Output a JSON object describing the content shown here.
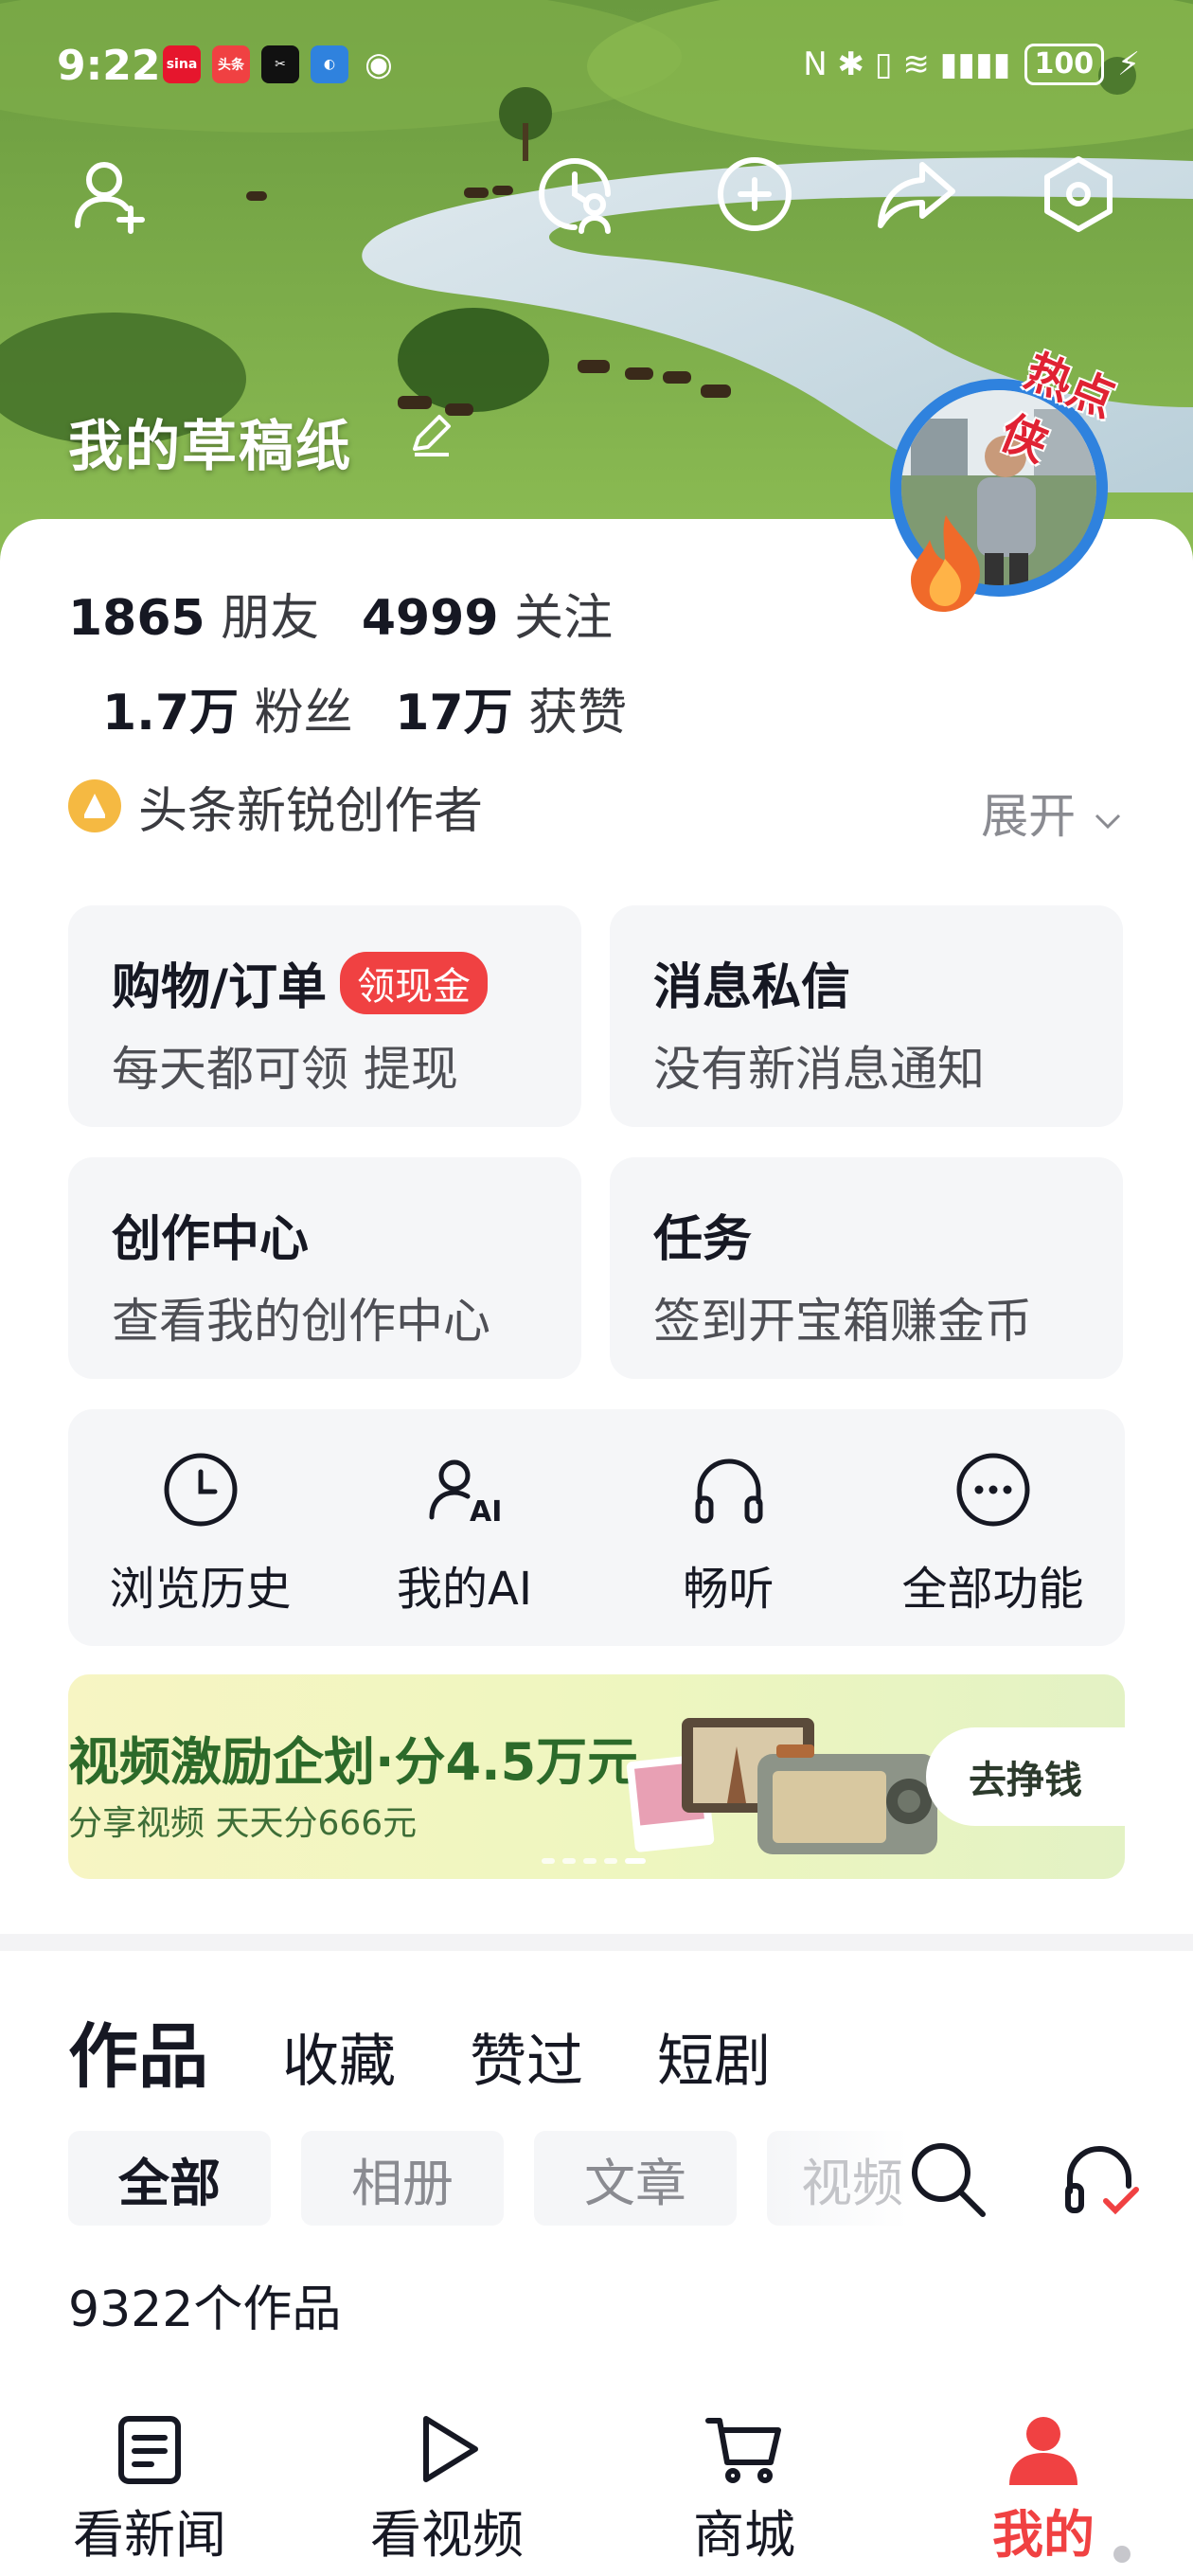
{
  "status_bar": {
    "time": "9:22",
    "apps": [
      {
        "name": "sina-app-icon",
        "text": "sina",
        "color": "#e6162d"
      },
      {
        "name": "toutiao-app-icon",
        "text": "头条",
        "color": "#f04142"
      },
      {
        "name": "capcut-app-icon",
        "text": "✂",
        "color": "#111111"
      },
      {
        "name": "browser-app-icon",
        "text": "◐",
        "color": "#2f82de"
      },
      {
        "name": "eye-app-icon",
        "text": "◉",
        "color": "transparent"
      }
    ],
    "signal_icons": "N ✱ ▯ ≋ ▮▮▮▮",
    "battery": "100"
  },
  "header": {
    "profile_name": "我的草稿纸",
    "avatar_badge": "热点侠"
  },
  "stats": {
    "friends_count": "1865",
    "friends_label": "朋友",
    "following_count": "4999",
    "following_label": "关注",
    "fans_count": "1.7万",
    "fans_label": "粉丝",
    "likes_count": "17万",
    "likes_label": "获赞"
  },
  "creator": {
    "badge_text": "头条新锐创作者",
    "expand_label": "展开"
  },
  "tiles": [
    {
      "title": "购物/订单",
      "tag": "领现金",
      "subtitle": "每天都可领 提现"
    },
    {
      "title": "消息私信",
      "subtitle": "没有新消息通知"
    },
    {
      "title": "创作中心",
      "subtitle": "查看我的创作中心"
    },
    {
      "title": "任务",
      "subtitle": "签到开宝箱赚金币"
    }
  ],
  "tools": [
    {
      "label": "浏览历史",
      "icon": "clock-icon"
    },
    {
      "label": "我的AI",
      "icon": "ai-user-icon"
    },
    {
      "label": "畅听",
      "icon": "headphones-icon"
    },
    {
      "label": "全部功能",
      "icon": "more-icon"
    }
  ],
  "banner": {
    "title": "视频激励企划·分4.5万元",
    "subtitle": "分享视频 天天分666元",
    "button": "去挣钱",
    "colors": {
      "title": "#2c6a2a",
      "bg": "#eef6bf"
    }
  },
  "content_tabs": [
    "作品",
    "收藏",
    "赞过",
    "短剧"
  ],
  "filters": [
    "全部",
    "相册",
    "文章",
    "视频"
  ],
  "works_count": "9322个作品",
  "bottom_nav": [
    {
      "label": "看新闻",
      "icon": "news-icon"
    },
    {
      "label": "看视频",
      "icon": "play-icon"
    },
    {
      "label": "商城",
      "icon": "cart-icon"
    },
    {
      "label": "我的",
      "icon": "profile-icon"
    }
  ],
  "accent": "#f04142"
}
